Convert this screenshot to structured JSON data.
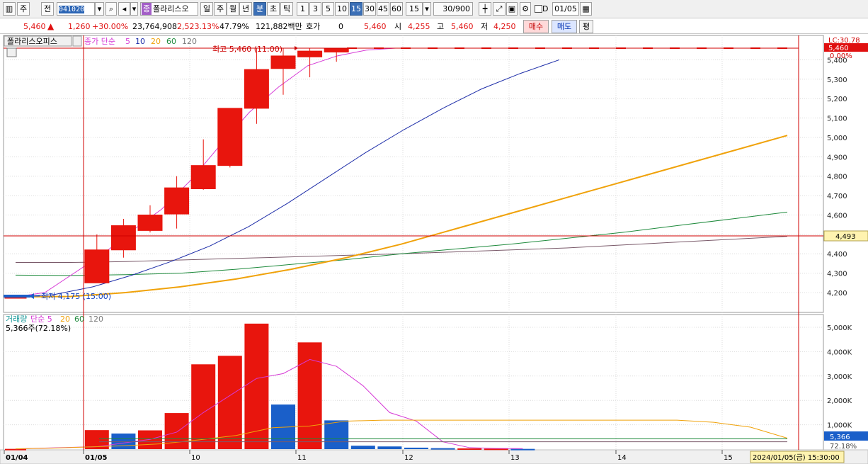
{
  "toolbar": {
    "market": "주",
    "mode": "전",
    "code": "041020",
    "stock_badge": "종",
    "stock_name": "폴라리스오",
    "periods": [
      "일",
      "주",
      "월",
      "년",
      "분",
      "초",
      "틱"
    ],
    "active_period": "분",
    "intervals": [
      "1",
      "3",
      "5",
      "10",
      "15",
      "30",
      "45",
      "60"
    ],
    "active_interval": "15",
    "interval_value": "15",
    "count": "30/900",
    "d_check_label": "D",
    "date": "01/05"
  },
  "quote": {
    "price": "5,460",
    "change": "1,260",
    "change_pct": "+30.00%",
    "volume": "23,764,908",
    "volume_pct": "2,523.13%",
    "ratio": "47.79%",
    "amount": "121,882백만",
    "hoga_label": "호가",
    "hoga_value": "0",
    "hoga_price": "5,460",
    "open_label": "시",
    "open": "4,255",
    "high_label": "고",
    "high": "5,460",
    "low_label": "저",
    "low": "4,250",
    "buy_label": "매수",
    "sell_label": "매도",
    "avg_label": "평"
  },
  "colors": {
    "up": "#e8150d",
    "down": "#1a5fc9",
    "ma5": "#d63ad6",
    "ma10": "#1c2ca8",
    "ma20": "#f0a20a",
    "ma60": "#1e8a3c",
    "ma120": "#7a5a6a",
    "crosshair": "#d00000"
  },
  "price_panel": {
    "stock_label": "폴라리스오피스",
    "legend": [
      {
        "text": "종가 단순",
        "color": "#d63ad6"
      },
      {
        "text": "5",
        "color": "#d63ad6"
      },
      {
        "text": "10",
        "color": "#1c2ca8"
      },
      {
        "text": "20",
        "color": "#f0a20a"
      },
      {
        "text": "60",
        "color": "#1e8a3c"
      },
      {
        "text": "120",
        "color": "#7a7a7a"
      }
    ],
    "high_annotation": "최고 5,460 (11:00)",
    "low_annotation": "최저 4,175 (15:00)",
    "lc_label": "LC:30.78",
    "current_price_tag": "5,460",
    "current_pct_tag": "0.00%",
    "crosshair_price_tag": "4,493",
    "y_ticks": [
      "5,400",
      "5,300",
      "5,200",
      "5,100",
      "5,000",
      "4,900",
      "4,800",
      "4,700",
      "4,600",
      "4,500",
      "4,400",
      "4,300",
      "4,200"
    ]
  },
  "volume_panel": {
    "legend": [
      {
        "text": "거래량",
        "color": "#1a9a9a"
      },
      {
        "text": "단순 5",
        "color": "#d63ad6"
      },
      {
        "text": "20",
        "color": "#f0a20a"
      },
      {
        "text": "60",
        "color": "#1e8a3c"
      },
      {
        "text": "120",
        "color": "#7a7a7a"
      }
    ],
    "cursor_value": "5,366주(72.18%)",
    "y_ticks": [
      "5,000K",
      "4,000K",
      "3,000K",
      "2,000K",
      "1,000K"
    ],
    "current_tag": "5,366",
    "pct_tag": "72.18%"
  },
  "x_axis": {
    "labels": [
      "01/04",
      "01/05",
      "10",
      "11",
      "12",
      "13",
      "14",
      "15"
    ],
    "cursor_time": "2024/01/05(금) 15:30:00"
  },
  "chart_data": {
    "type": "candlestick",
    "interval_minutes": 15,
    "date": "2024/01/05",
    "ylim": [
      4150,
      5500
    ],
    "candles": [
      {
        "t": "01/04 15:15",
        "open": 4175,
        "high": 4180,
        "low": 4175,
        "close": 4178
      },
      {
        "t": "09:00",
        "open": 4250,
        "high": 4500,
        "low": 4250,
        "close": 4420
      },
      {
        "t": "09:15",
        "open": 4420,
        "high": 4580,
        "low": 4380,
        "close": 4545
      },
      {
        "t": "09:30",
        "open": 4520,
        "high": 4650,
        "low": 4510,
        "close": 4600
      },
      {
        "t": "09:45",
        "open": 4605,
        "high": 4800,
        "low": 4530,
        "close": 4740
      },
      {
        "t": "10:00",
        "open": 4735,
        "high": 4990,
        "low": 4730,
        "close": 4855
      },
      {
        "t": "10:15",
        "open": 4855,
        "high": 5150,
        "low": 4845,
        "close": 5150
      },
      {
        "t": "10:30",
        "open": 5150,
        "high": 5460,
        "low": 5070,
        "close": 5350
      },
      {
        "t": "10:45",
        "open": 5355,
        "high": 5460,
        "low": 5220,
        "close": 5420
      },
      {
        "t": "11:00",
        "open": 5415,
        "high": 5460,
        "low": 5310,
        "close": 5445
      },
      {
        "t": "11:15",
        "open": 5440,
        "high": 5460,
        "low": 5390,
        "close": 5460
      }
    ],
    "flat_after": {
      "from": "11:30",
      "to": "15:30",
      "price": 5460
    },
    "ma": {
      "5": [
        4178,
        4200,
        4300,
        4400,
        4520,
        4630,
        4780,
        4960,
        5130,
        5260,
        5370,
        5420,
        5450,
        5460,
        5460
      ],
      "10": [
        4178,
        4190,
        4230,
        4290,
        4360,
        4440,
        4540,
        4660,
        4790,
        4920,
        5040,
        5150,
        5250,
        5330,
        5400
      ],
      "20": [
        4178,
        4180,
        4200,
        4230,
        4270,
        4320,
        4380,
        4450,
        4530,
        4610,
        4690,
        4770,
        4850,
        4930,
        5010
      ],
      "60": [
        4290,
        4288,
        4292,
        4300,
        4320,
        4345,
        4370,
        4400,
        4425,
        4450,
        4480,
        4510,
        4545,
        4580,
        4615
      ],
      "120": [
        4355,
        4355,
        4360,
        4368,
        4376,
        4384,
        4392,
        4400,
        4410,
        4420,
        4430,
        4445,
        4460,
        4475,
        4490
      ]
    },
    "volume": {
      "unit": "shares",
      "bars": [
        {
          "t": "01/04 15:15",
          "value": 10000,
          "dir": "up"
        },
        {
          "t": "09:00",
          "value": 780000,
          "dir": "up"
        },
        {
          "t": "09:15",
          "value": 640000,
          "dir": "down"
        },
        {
          "t": "09:30",
          "value": 770000,
          "dir": "up"
        },
        {
          "t": "09:45",
          "value": 1480000,
          "dir": "up"
        },
        {
          "t": "10:00",
          "value": 3480000,
          "dir": "up"
        },
        {
          "t": "10:15",
          "value": 3830000,
          "dir": "up"
        },
        {
          "t": "10:30",
          "value": 5150000,
          "dir": "up"
        },
        {
          "t": "10:45",
          "value": 1830000,
          "dir": "down"
        },
        {
          "t": "11:00",
          "value": 4380000,
          "dir": "up"
        },
        {
          "t": "11:15",
          "value": 1180000,
          "dir": "down"
        },
        {
          "t": "11:30",
          "value": 140000,
          "dir": "down"
        },
        {
          "t": "11:45",
          "value": 110000,
          "dir": "down"
        },
        {
          "t": "12:00",
          "value": 60000,
          "dir": "down"
        },
        {
          "t": "12:30",
          "value": 40000,
          "dir": "down"
        },
        {
          "t": "13:00",
          "value": 30000,
          "dir": "up"
        },
        {
          "t": "13:30",
          "value": 20000,
          "dir": "up"
        },
        {
          "t": "14:00",
          "value": 10000,
          "dir": "down"
        }
      ],
      "ma5": [
        10000,
        100000,
        250000,
        400000,
        700000,
        1500000,
        2200000,
        2900000,
        3100000,
        3680000,
        3400000,
        2600000,
        1500000,
        1150000,
        300000,
        60000,
        30000,
        20000
      ],
      "ma20": [
        10000,
        40000,
        90000,
        140000,
        220000,
        380000,
        560000,
        880000,
        950000,
        1150000,
        1190000,
        1190000,
        1190000,
        1190000,
        1190000,
        1190000,
        1190000,
        1190000,
        1190000,
        1100000,
        900000,
        450000
      ],
      "ma60": 420000,
      "ma120": 300000
    }
  }
}
